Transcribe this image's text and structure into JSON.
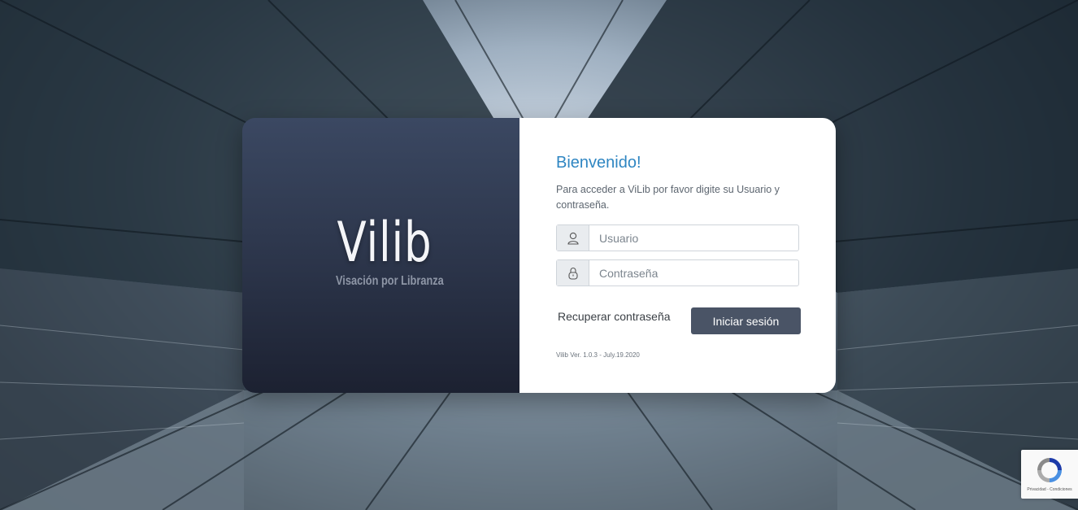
{
  "brand": {
    "logo_text": "Vilib",
    "logo_subtitle": "Visación por Libranza"
  },
  "login": {
    "title": "Bienvenido!",
    "intro": "Para acceder a ViLib por favor digite su Usuario y contraseña.",
    "username": {
      "placeholder": "Usuario",
      "value": "",
      "icon": "user-icon"
    },
    "password": {
      "placeholder": "Contraseña",
      "value": "",
      "icon": "lock-icon"
    },
    "recover_label": "Recuperar contraseña",
    "submit_label": "Iniciar sesión",
    "version": "Vilib Ver. 1.0.3 - July.19.2020"
  },
  "recaptcha": {
    "text": "Privacidad - Condiciones"
  },
  "colors": {
    "title": "#2f86c2",
    "button": "#4a5466",
    "brand_panel": "#2b3449"
  }
}
